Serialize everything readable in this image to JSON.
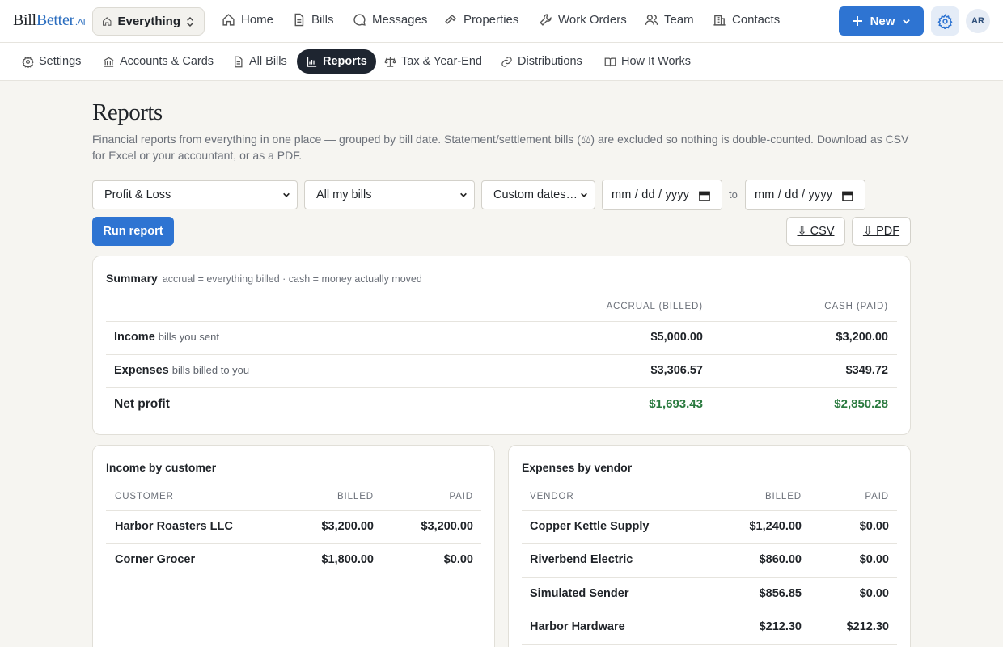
{
  "app": {
    "logo_main": "Bill",
    "logo_accent": "Better",
    "logo_suffix": ".AI",
    "workspace": "Everything",
    "nav": [
      "Home",
      "Bills",
      "Messages",
      "Properties",
      "Work Orders",
      "Team",
      "Contacts"
    ],
    "new_label": "New",
    "avatar_initials": "AR",
    "accent_color": "#2e74d2"
  },
  "subnav": [
    "Settings",
    "Accounts & Cards",
    "All Bills",
    "Reports",
    "Tax & Year-End",
    "Distributions",
    "How It Works"
  ],
  "subnav_active": "Reports",
  "page": {
    "title": "Reports",
    "description": "Financial reports from everything in one place — grouped by bill date. Statement/settlement bills (⚖) are excluded so nothing is double-counted. Download as CSV for Excel or your accountant, or as a PDF."
  },
  "controls": {
    "report_type": "Profit & Loss",
    "scope": "All my bills",
    "range": "Custom dates…",
    "date_from_placeholder": "mm / dd / yyyy",
    "date_to_placeholder": "mm / dd / yyyy",
    "to_label": "to",
    "run_label": "Run report",
    "csv_label": "⇩ CSV",
    "pdf_label": "⇩ PDF"
  },
  "summary": {
    "title": "Summary",
    "subtitle": "accrual = everything billed · cash = money actually moved",
    "col_accrual": "ACCRUAL (BILLED)",
    "col_cash": "CASH (PAID)",
    "rows": [
      {
        "label": "Income",
        "note": "bills you sent",
        "accrual": "$5,000.00",
        "cash": "$3,200.00"
      },
      {
        "label": "Expenses",
        "note": "bills billed to you",
        "accrual": "$3,306.57",
        "cash": "$349.72"
      }
    ],
    "net_label": "Net profit",
    "net_accrual": "$1,693.43",
    "net_cash": "$2,850.28",
    "positive_color": "#2a7a3f"
  },
  "income": {
    "title": "Income by customer",
    "col_name": "CUSTOMER",
    "col_billed": "BILLED",
    "col_paid": "PAID",
    "rows": [
      {
        "name": "Harbor Roasters LLC",
        "billed": "$3,200.00",
        "paid": "$3,200.00"
      },
      {
        "name": "Corner Grocer",
        "billed": "$1,800.00",
        "paid": "$0.00"
      }
    ]
  },
  "expenses": {
    "title": "Expenses by vendor",
    "col_name": "VENDOR",
    "col_billed": "BILLED",
    "col_paid": "PAID",
    "rows": [
      {
        "name": "Copper Kettle Supply",
        "billed": "$1,240.00",
        "paid": "$0.00"
      },
      {
        "name": "Riverbend Electric",
        "billed": "$860.00",
        "paid": "$0.00"
      },
      {
        "name": "Simulated Sender",
        "billed": "$856.85",
        "paid": "$0.00"
      },
      {
        "name": "Harbor Hardware",
        "billed": "$212.30",
        "paid": "$212.30"
      }
    ]
  }
}
